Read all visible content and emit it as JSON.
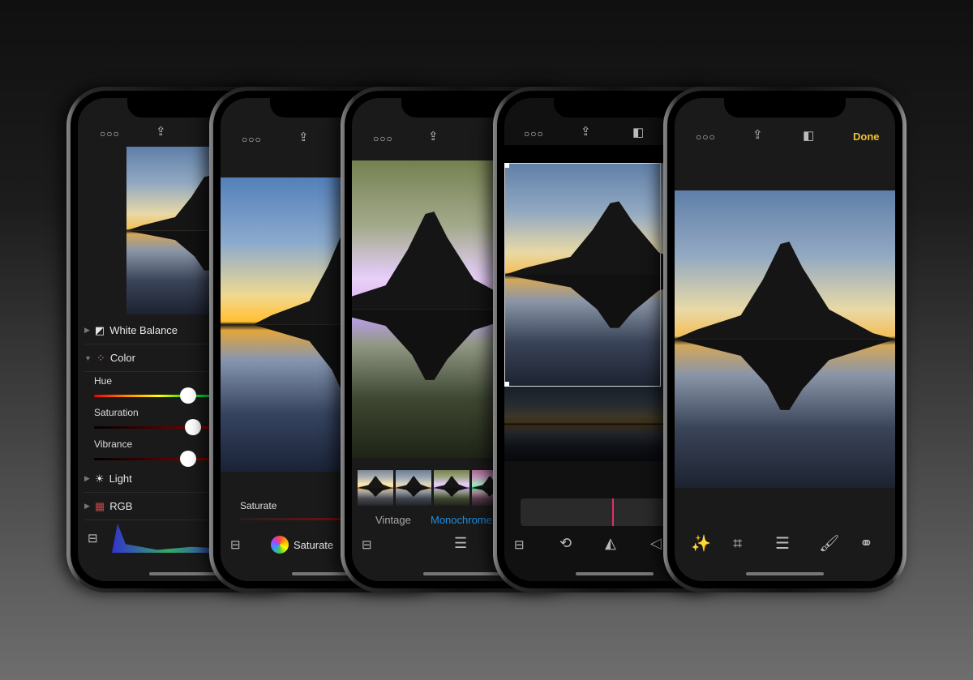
{
  "phone1": {
    "menu_icon": "more-dots-icon",
    "share_icon": "share-icon",
    "sections": [
      {
        "label": "White Balance",
        "icon": "white-balance-icon",
        "expanded": false
      },
      {
        "label": "Color",
        "icon": "color-dots-icon",
        "expanded": true
      },
      {
        "label": "Light",
        "icon": "sun-icon",
        "expanded": false
      },
      {
        "label": "RGB",
        "icon": "rgb-grid-icon",
        "expanded": false
      }
    ],
    "sliders": [
      {
        "label": "Hue",
        "value": 0.84
      },
      {
        "label": "Saturation",
        "value": 0.88
      },
      {
        "label": "Vibrance",
        "value": 0.84
      }
    ]
  },
  "phone2": {
    "slider_label": "Saturate",
    "tool_label": "Saturate"
  },
  "phone3": {
    "filters": [
      "Vintage",
      "Monochrome"
    ],
    "selected_filter": "Monochrome",
    "accent": "#1e90e0"
  },
  "phone4": {},
  "phone5": {
    "done_label": "Done",
    "done_color": "#f0c030",
    "tools": [
      "magic-wand-icon",
      "crop-icon",
      "sliders-icon",
      "brush-icon",
      "overlay-circles-icon"
    ]
  }
}
